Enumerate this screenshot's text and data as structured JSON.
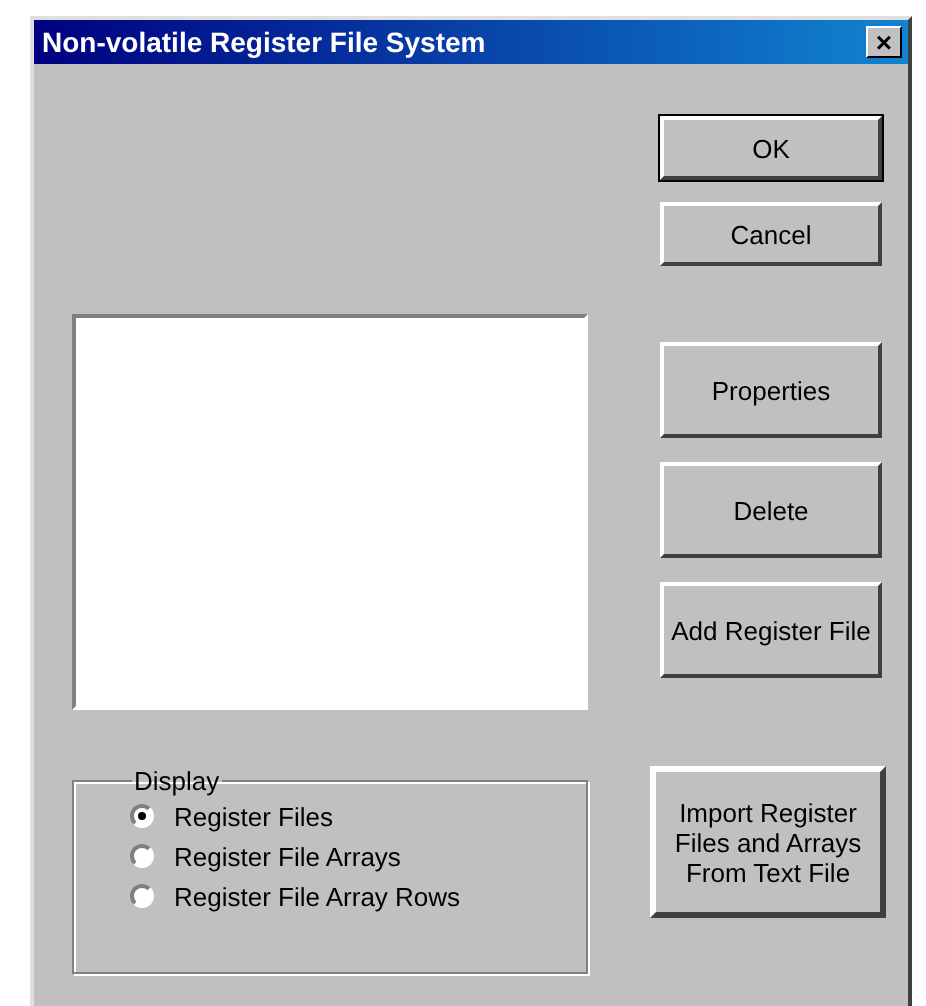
{
  "window": {
    "title": "Non-volatile Register File System",
    "close_label": "×"
  },
  "buttons": [
    {
      "label": "OK",
      "default": true
    },
    {
      "label": "Cancel",
      "default": false
    }
  ],
  "side_buttons": [
    {
      "label": "Properties"
    },
    {
      "label": "Delete"
    },
    {
      "label": "Add Register File"
    }
  ],
  "display": {
    "legend": "Display",
    "options": [
      {
        "label": "Register Files",
        "selected": true
      },
      {
        "label": "Register File Arrays",
        "selected": false
      },
      {
        "label": "Register File Array Rows",
        "selected": false
      }
    ]
  },
  "import_button": {
    "label": "Import Register Files and Arrays From Text File"
  }
}
